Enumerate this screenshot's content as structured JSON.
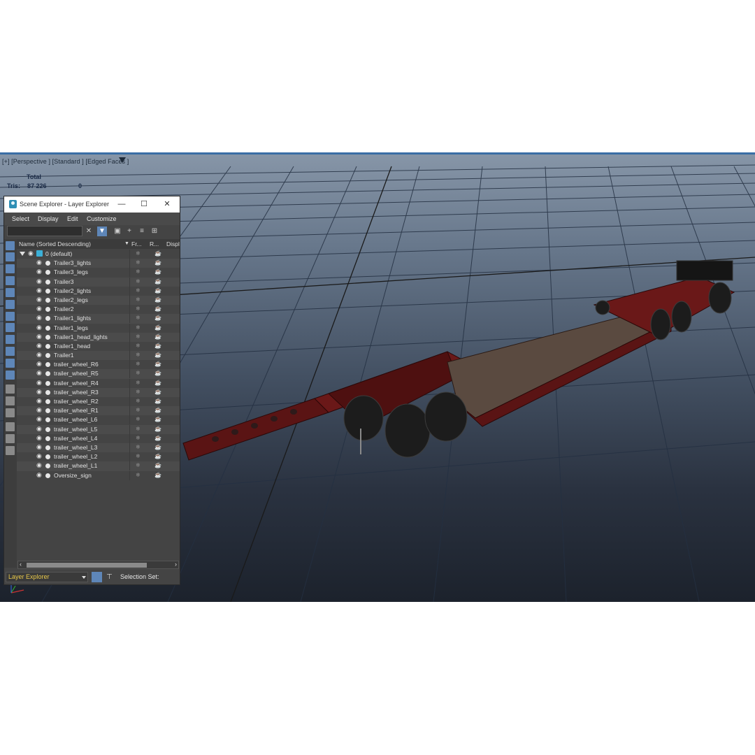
{
  "viewport": {
    "label": "[+] [Perspective ] [Standard ] [Edged Faces ]",
    "filter_icon": "funnel-icon",
    "stats": {
      "header": "Total",
      "label": "Tris:",
      "total": "87 226",
      "selected": "0"
    },
    "model_colors": {
      "frame": "#6e1a1a",
      "deck": "#5a4a40",
      "tire": "#1c1c1c",
      "sign": "#151515"
    }
  },
  "panel": {
    "title": "Scene Explorer - Layer Explorer",
    "window_buttons": {
      "minimize": "—",
      "maximize": "☐",
      "close": "✕"
    },
    "menu": [
      "Select",
      "Display",
      "Edit",
      "Customize"
    ],
    "search": {
      "value": "",
      "placeholder": ""
    },
    "columns": {
      "name": "Name (Sorted Descending)",
      "freeze": "Fr...",
      "render": "R...",
      "display": "Displ"
    },
    "root_layer": "0 (default)",
    "layers": [
      "Trailer3_lights",
      "Trailer3_legs",
      "Trailer3",
      "Trailer2_lights",
      "Trailer2_legs",
      "Trailer2",
      "Trailer1_lights",
      "Trailer1_legs",
      "Trailer1_head_lights",
      "Trailer1_head",
      "Trailer1",
      "trailer_wheel_R6",
      "trailer_wheel_R5",
      "trailer_wheel_R4",
      "trailer_wheel_R3",
      "trailer_wheel_R2",
      "trailer_wheel_R1",
      "trailer_wheel_L6",
      "trailer_wheel_L5",
      "trailer_wheel_L4",
      "trailer_wheel_L3",
      "trailer_wheel_L2",
      "trailer_wheel_L1",
      "Oversize_sign"
    ],
    "explorer_select": "Layer Explorer",
    "selection_set_label": "Selection Set:",
    "accent": "#5e86b8"
  }
}
